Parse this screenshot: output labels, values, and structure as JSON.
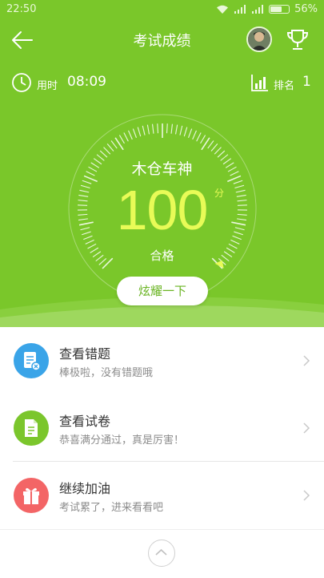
{
  "status_bar": {
    "time": "22:50",
    "battery": "56%"
  },
  "header": {
    "title": "考试成绩"
  },
  "stats": {
    "time_label": "用时",
    "time_value": "08:09",
    "rank_label": "排名",
    "rank_value": "1"
  },
  "result": {
    "name": "木仓车神",
    "score": "100",
    "score_unit": "分",
    "status": "合格",
    "share_label": "炫耀一下"
  },
  "menu": [
    {
      "title": "查看错题",
      "subtitle": "棒极啦，没有错题哦",
      "color": "#3aa4e8",
      "icon": "wrong-answers-icon"
    },
    {
      "title": "查看试卷",
      "subtitle": "恭喜满分通过，真是厉害！",
      "color": "#7bc62c",
      "icon": "paper-icon"
    },
    {
      "title": "继续加油",
      "subtitle": "考试累了，进来看看吧",
      "color": "#f36566",
      "icon": "gift-icon"
    }
  ],
  "colors": {
    "primary": "#7ac72a",
    "score": "#e8fb57"
  }
}
